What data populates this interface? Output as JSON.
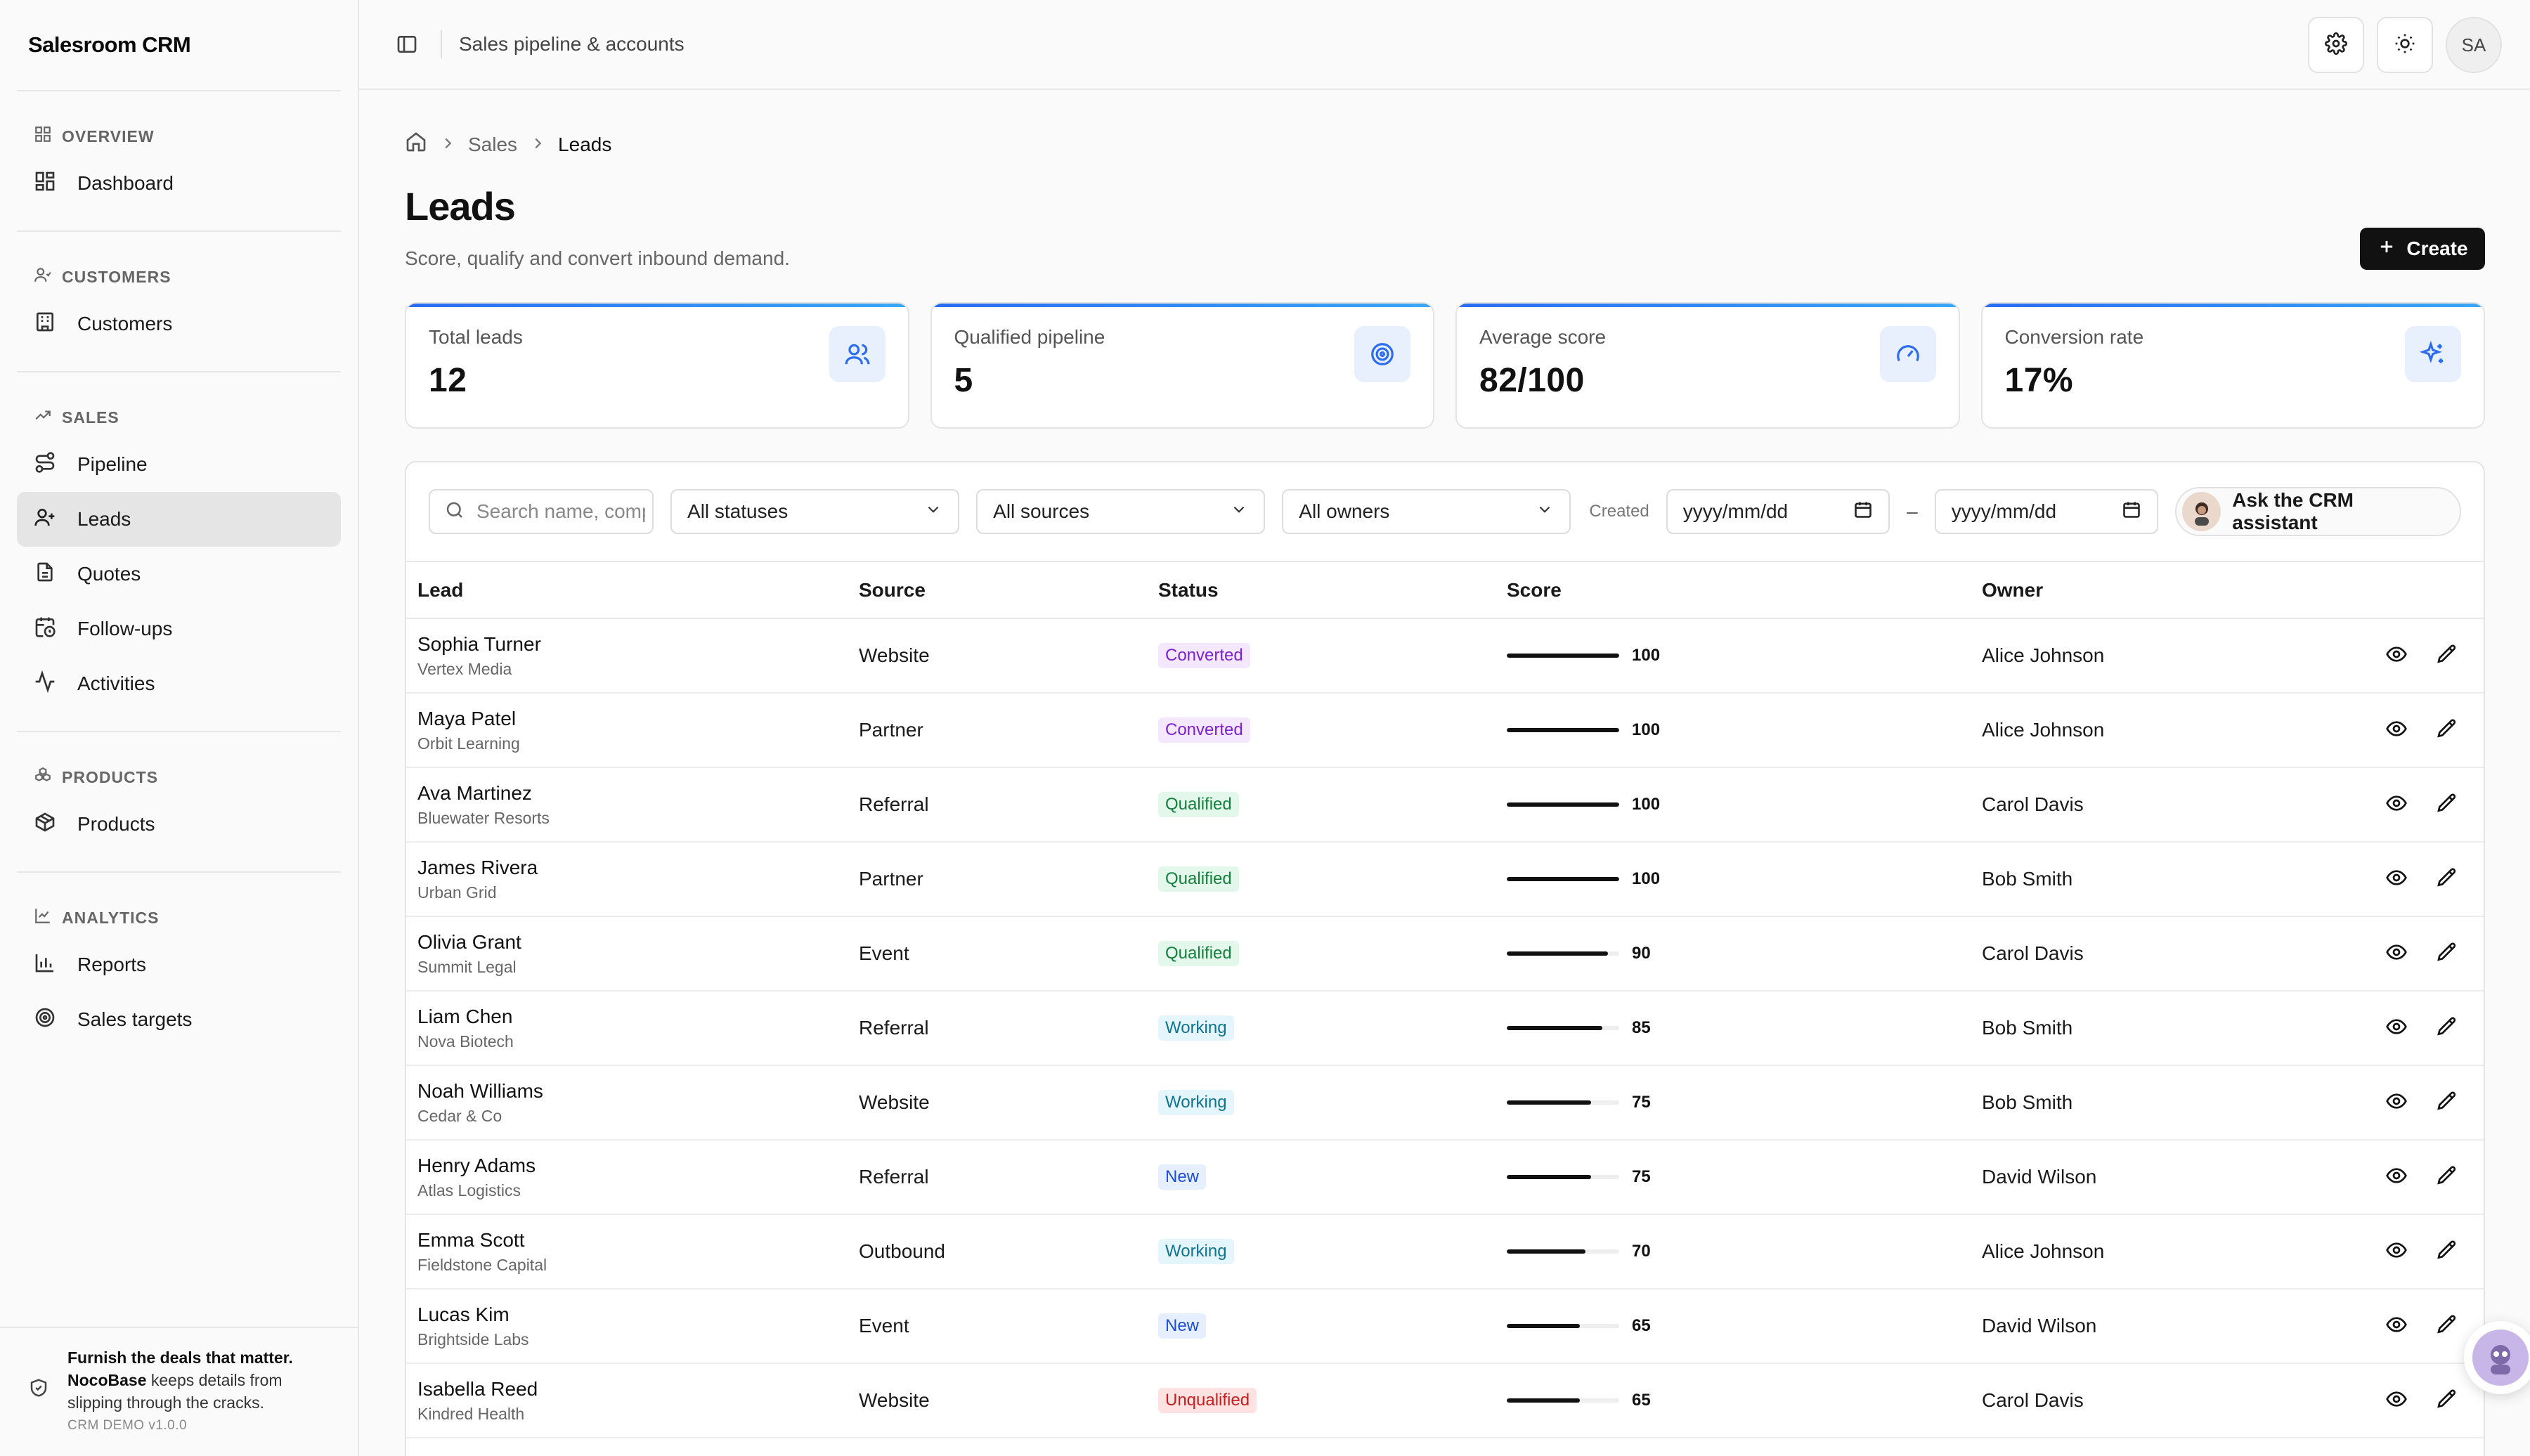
{
  "app": {
    "brand": "Salesroom CRM",
    "page_context": "Sales pipeline & accounts",
    "avatar_initials": "SA"
  },
  "sidebar": {
    "groups": [
      {
        "label": "OVERVIEW",
        "items": [
          {
            "label": "Dashboard"
          }
        ]
      },
      {
        "label": "CUSTOMERS",
        "items": [
          {
            "label": "Customers"
          }
        ]
      },
      {
        "label": "SALES",
        "items": [
          {
            "label": "Pipeline"
          },
          {
            "label": "Leads"
          },
          {
            "label": "Quotes"
          },
          {
            "label": "Follow-ups"
          },
          {
            "label": "Activities"
          }
        ]
      },
      {
        "label": "PRODUCTS",
        "items": [
          {
            "label": "Products"
          }
        ]
      },
      {
        "label": "ANALYTICS",
        "items": [
          {
            "label": "Reports"
          },
          {
            "label": "Sales targets"
          }
        ]
      }
    ],
    "active_item": "Leads",
    "footer": {
      "headline": "Furnish the deals that matter.",
      "brand": "NocoBase",
      "body": " keeps details from slipping through the cracks.",
      "version": "CRM DEMO v1.0.0"
    }
  },
  "breadcrumb": {
    "items": [
      "Sales",
      "Leads"
    ]
  },
  "page": {
    "title": "Leads",
    "subtitle": "Score, qualify and convert inbound demand.",
    "create_label": "Create"
  },
  "stats": [
    {
      "label": "Total leads",
      "value": "12",
      "icon": "users-icon"
    },
    {
      "label": "Qualified pipeline",
      "value": "5",
      "icon": "target-icon"
    },
    {
      "label": "Average score",
      "value": "82/100",
      "icon": "gauge-icon"
    },
    {
      "label": "Conversion rate",
      "value": "17%",
      "icon": "sparkles-icon"
    }
  ],
  "filters": {
    "search_placeholder": "Search name, company",
    "status": "All statuses",
    "source": "All sources",
    "owner": "All owners",
    "created_label": "Created",
    "date_from": "yyyy/mm/dd",
    "date_to": "yyyy/mm/dd",
    "date_sep": "–",
    "assistant_label": "Ask the CRM assistant"
  },
  "table": {
    "columns": [
      "Lead",
      "Source",
      "Status",
      "Score",
      "Owner"
    ],
    "rows": [
      {
        "name": "Sophia Turner",
        "company": "Vertex Media",
        "source": "Website",
        "status": "Converted",
        "score": 100,
        "owner": "Alice Johnson"
      },
      {
        "name": "Maya Patel",
        "company": "Orbit Learning",
        "source": "Partner",
        "status": "Converted",
        "score": 100,
        "owner": "Alice Johnson"
      },
      {
        "name": "Ava Martinez",
        "company": "Bluewater Resorts",
        "source": "Referral",
        "status": "Qualified",
        "score": 100,
        "owner": "Carol Davis"
      },
      {
        "name": "James Rivera",
        "company": "Urban Grid",
        "source": "Partner",
        "status": "Qualified",
        "score": 100,
        "owner": "Bob Smith"
      },
      {
        "name": "Olivia Grant",
        "company": "Summit Legal",
        "source": "Event",
        "status": "Qualified",
        "score": 90,
        "owner": "Carol Davis"
      },
      {
        "name": "Liam Chen",
        "company": "Nova Biotech",
        "source": "Referral",
        "status": "Working",
        "score": 85,
        "owner": "Bob Smith"
      },
      {
        "name": "Noah Williams",
        "company": "Cedar & Co",
        "source": "Website",
        "status": "Working",
        "score": 75,
        "owner": "Bob Smith"
      },
      {
        "name": "Henry Adams",
        "company": "Atlas Logistics",
        "source": "Referral",
        "status": "New",
        "score": 75,
        "owner": "David Wilson"
      },
      {
        "name": "Emma Scott",
        "company": "Fieldstone Capital",
        "source": "Outbound",
        "status": "Working",
        "score": 70,
        "owner": "Alice Johnson"
      },
      {
        "name": "Lucas Kim",
        "company": "Brightside Labs",
        "source": "Event",
        "status": "New",
        "score": 65,
        "owner": "David Wilson"
      },
      {
        "name": "Isabella Reed",
        "company": "Kindred Health",
        "source": "Website",
        "status": "Unqualified",
        "score": 65,
        "owner": "Carol Davis"
      }
    ]
  },
  "colors": {
    "accent_blue": "#2b6cf0",
    "primary_button": "#111111"
  }
}
